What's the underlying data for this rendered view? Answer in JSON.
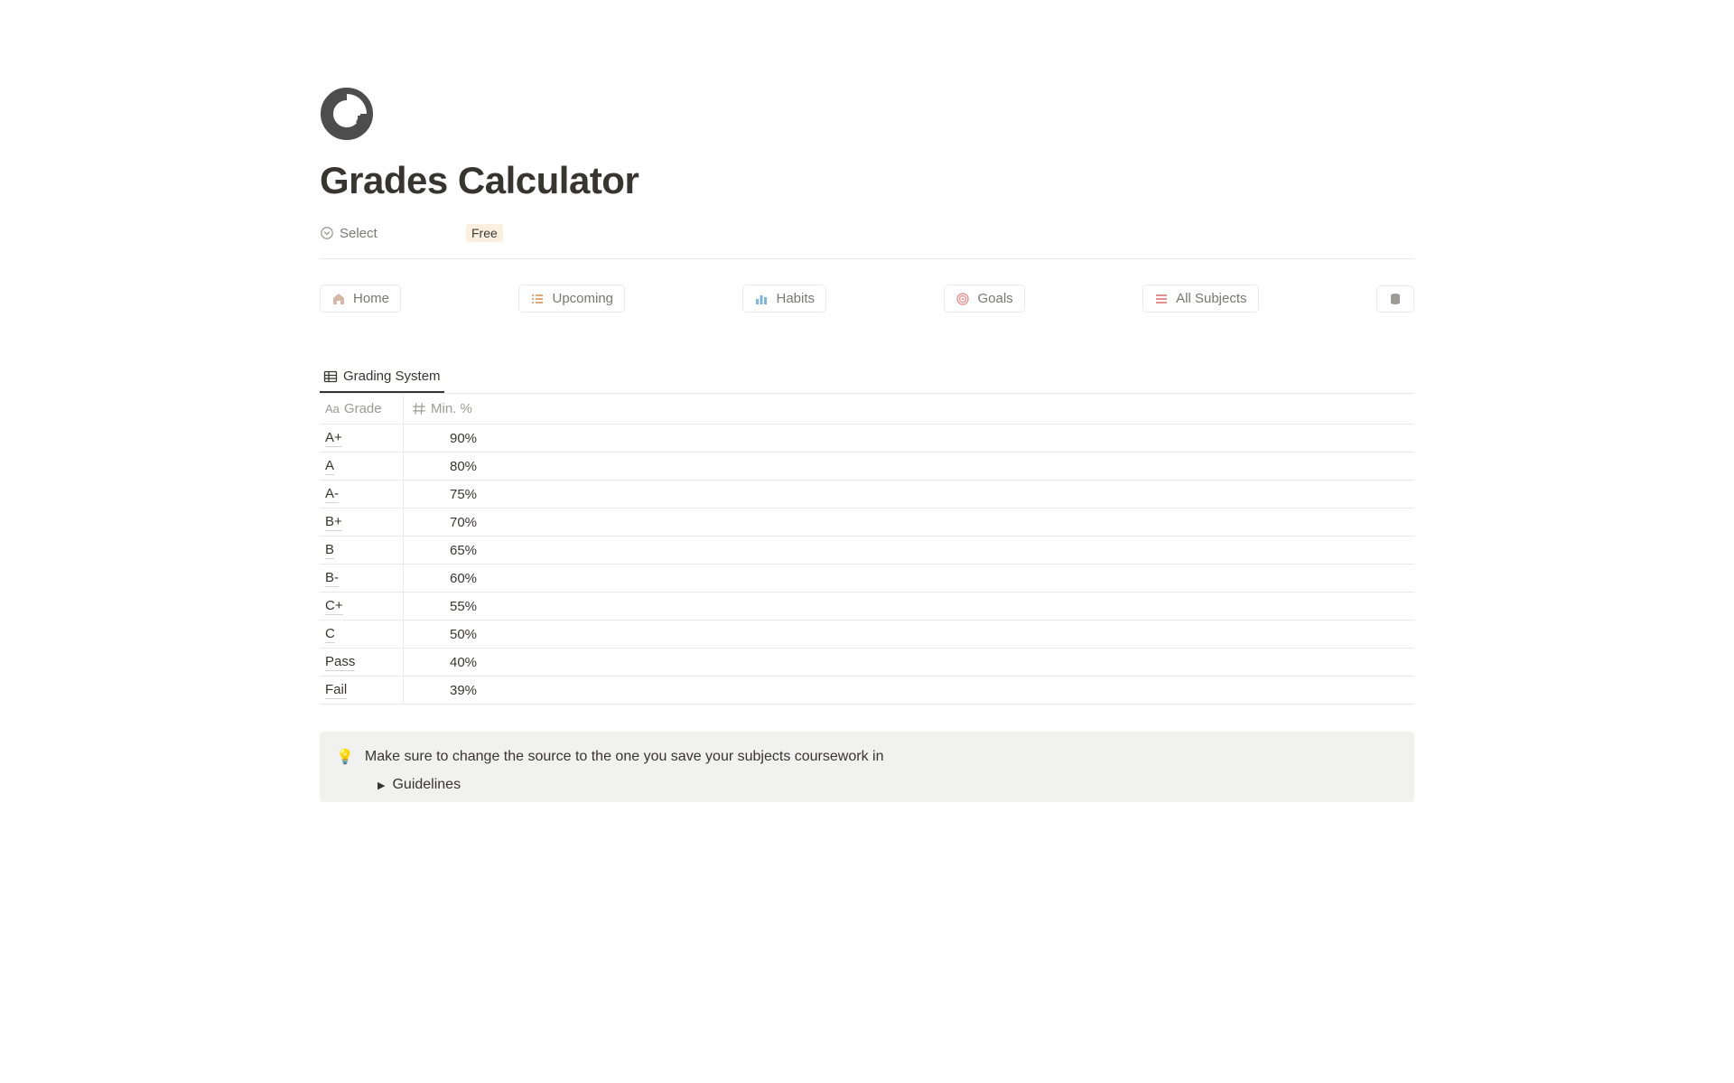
{
  "page": {
    "title": "Grades Calculator",
    "select_label": "Select",
    "select_tag": "Free"
  },
  "nav": {
    "home": "Home",
    "upcoming": "Upcoming",
    "habits": "Habits",
    "goals": "Goals",
    "all_subjects": "All Subjects"
  },
  "view": {
    "tab_label": "Grading System"
  },
  "columns": {
    "grade": "Grade",
    "min": "Min. %"
  },
  "rows": [
    {
      "grade": "A+",
      "min": "90%"
    },
    {
      "grade": "A",
      "min": "80%"
    },
    {
      "grade": "A-",
      "min": "75%"
    },
    {
      "grade": "B+",
      "min": "70%"
    },
    {
      "grade": "B",
      "min": "65%"
    },
    {
      "grade": "B-",
      "min": "60%"
    },
    {
      "grade": "C+",
      "min": "55%"
    },
    {
      "grade": "C",
      "min": "50%"
    },
    {
      "grade": "Pass",
      "min": "40%"
    },
    {
      "grade": "Fail",
      "min": "39%"
    }
  ],
  "callout": {
    "text": "Make sure to change the source to the one you save your subjects coursework in",
    "guidelines": "Guidelines"
  }
}
